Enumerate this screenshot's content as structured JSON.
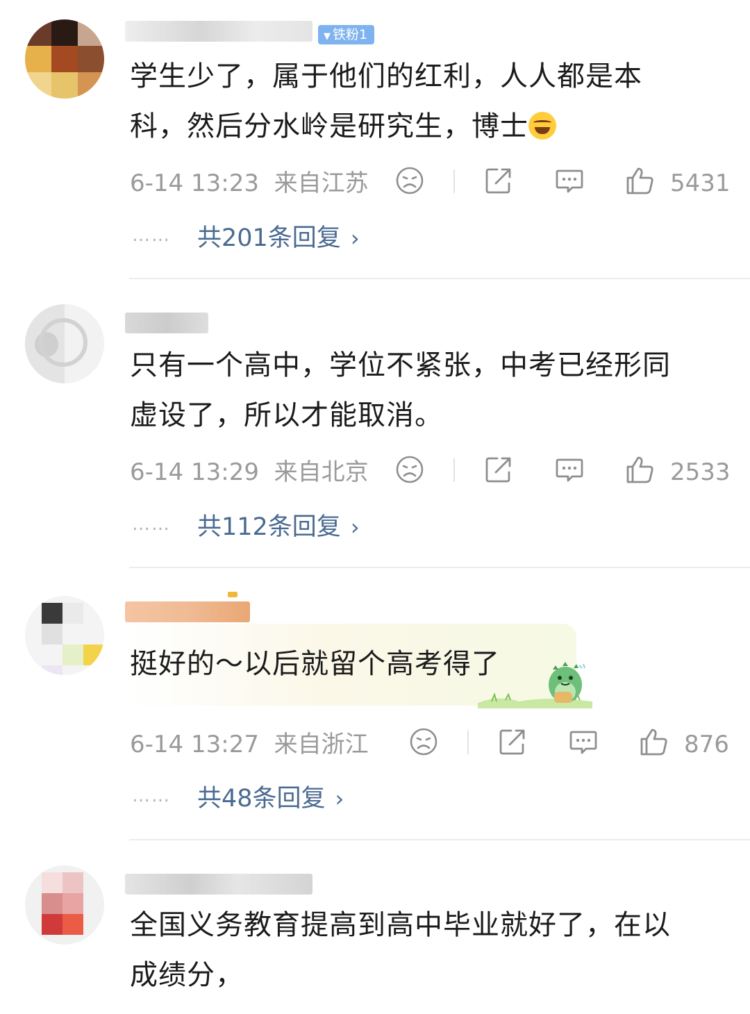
{
  "comments": [
    {
      "badge": "铁粉1",
      "text_line1": "学生少了，属于他们的红利，人人都是本",
      "text_line2": "科，然后分水岭是研究生，博士",
      "time": "6-14 13:23",
      "location": "来自江苏",
      "likes": "5431",
      "replies": "共201条回复"
    },
    {
      "text_line1": "只有一个高中，学位不紧张，中考已经形同",
      "text_line2": "虚设了，所以才能取消。",
      "time": "6-14 13:29",
      "location": "来自北京",
      "likes": "2533",
      "replies": "共112条回复"
    },
    {
      "text_line1": "挺好的～以后就留个高考得了",
      "time": "6-14 13:27",
      "location": "来自浙江",
      "likes": "876",
      "replies": "共48条回复"
    },
    {
      "text_line1": "全国义务教育提高到高中毕业就好了，在以",
      "text_line2": "成绩分，"
    }
  ],
  "ui": {
    "dots": "……",
    "chevron": "›"
  },
  "icons": {
    "dislike": "sad-face-icon",
    "share": "share-icon",
    "comment": "comment-icon",
    "like": "thumbs-up-icon",
    "laugh": "laughing-emoji-icon",
    "sticker": "green-dinosaur-sticker"
  },
  "colors": {
    "text": "#1b1b1b",
    "meta": "#9a9a9a",
    "reply_link": "#4a6a92",
    "badge": "#7fb3f0"
  }
}
